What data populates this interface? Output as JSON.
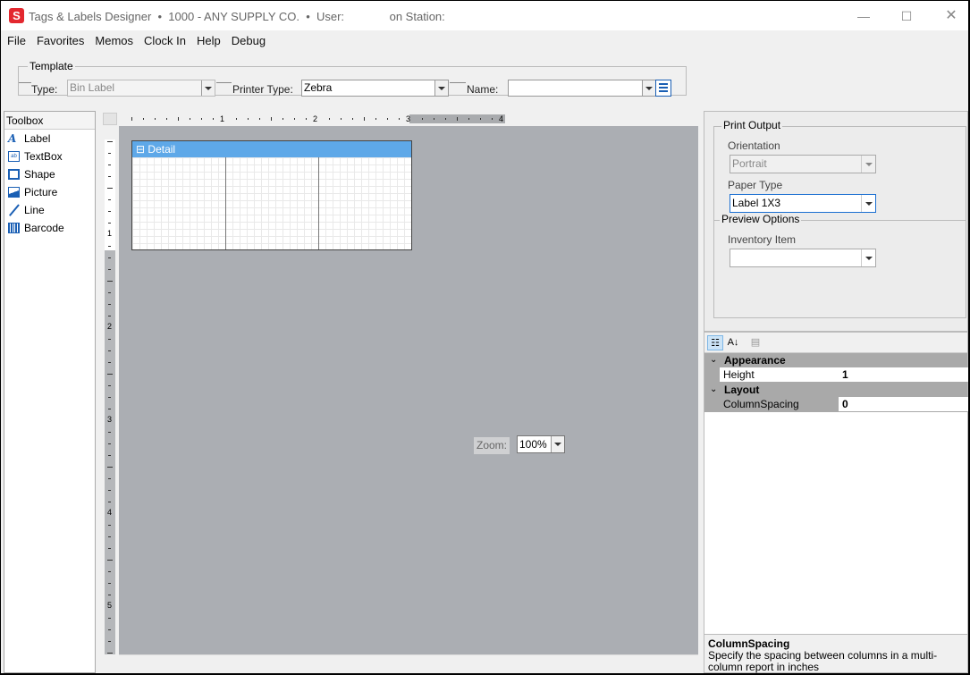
{
  "window": {
    "title": "Tags & Labels Designer  •  1000 - ANY SUPPLY CO.  •  User:              on Station:",
    "app_icon_letter": "S",
    "min_glyph": "—",
    "max_glyph": "☐",
    "close_glyph": "✕"
  },
  "menu": [
    "File",
    "Favorites",
    "Memos",
    "Clock In",
    "Help",
    "Debug"
  ],
  "template": {
    "legend": "Template",
    "type_label": "Type:",
    "type_value": "Bin Label",
    "printer_label": "Printer Type:",
    "printer_value": "Zebra",
    "name_label": "Name:",
    "name_value": ""
  },
  "toolbox": {
    "title": "Toolbox",
    "items": [
      {
        "label": "Label",
        "icon": "label-icon"
      },
      {
        "label": "TextBox",
        "icon": "textbox-icon"
      },
      {
        "label": "Shape",
        "icon": "shape-icon"
      },
      {
        "label": "Picture",
        "icon": "picture-icon"
      },
      {
        "label": "Line",
        "icon": "line-icon"
      },
      {
        "label": "Barcode",
        "icon": "barcode-icon"
      }
    ]
  },
  "designer": {
    "hruler_numbers": [
      "1",
      "2",
      "3",
      "4"
    ],
    "vruler_numbers": [
      "1",
      "2",
      "3",
      "4",
      "5"
    ],
    "band_title": "Detail",
    "band_collapse_glyph": "⊟",
    "zoom_label": "Zoom:",
    "zoom_value": "100%"
  },
  "print_output": {
    "legend": "Print Output",
    "orientation_label": "Orientation",
    "orientation_value": "Portrait",
    "paper_type_label": "Paper Type",
    "paper_type_value": "Label 1X3"
  },
  "preview_options": {
    "legend": "Preview Options",
    "inventory_label": "Inventory Item",
    "inventory_value": ""
  },
  "property_grid": {
    "categorized_glyph": "☷",
    "alpha_glyph": "A↓",
    "pages_glyph": "▤",
    "categories": [
      {
        "name": "Appearance",
        "props": [
          {
            "name": "Height",
            "value": "1"
          }
        ]
      },
      {
        "name": "Layout",
        "props": [
          {
            "name": "ColumnSpacing",
            "value": "0"
          }
        ]
      }
    ],
    "description_title": "ColumnSpacing",
    "description_text": "Specify the spacing between columns in a multi-column report in inches"
  }
}
